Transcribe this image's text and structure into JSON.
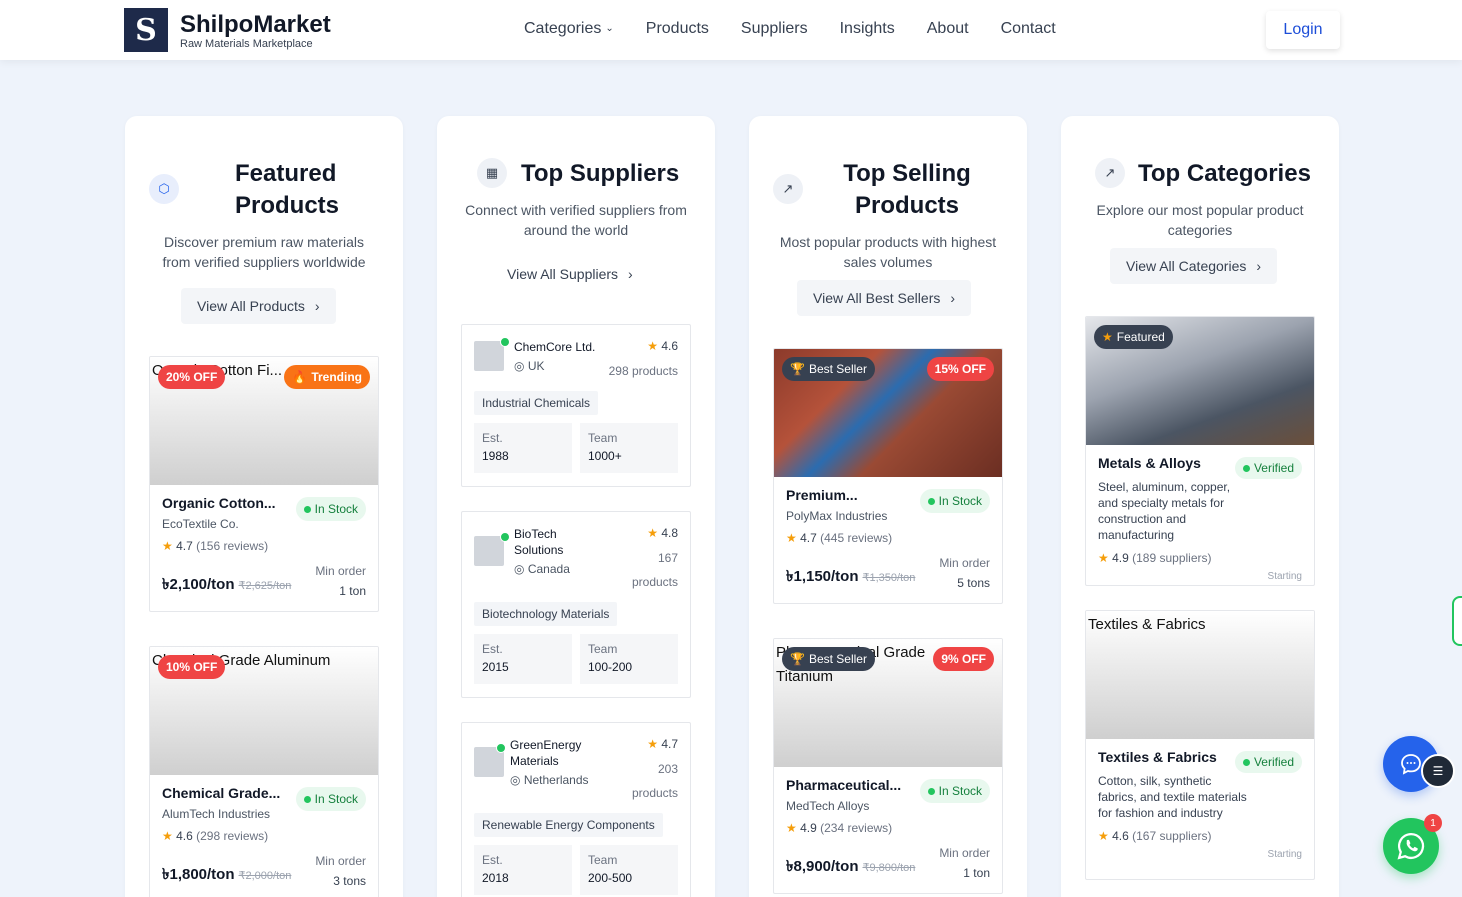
{
  "header": {
    "logo_letter": "S",
    "brand_name": "ShilpoMarket",
    "brand_tagline": "Raw Materials Marketplace",
    "nav": [
      "Categories",
      "Products",
      "Suppliers",
      "Insights",
      "About",
      "Contact"
    ],
    "login": "Login"
  },
  "featured": {
    "title_1": "Featured",
    "title_2": "Products",
    "desc_1": "Discover premium raw materials",
    "desc_2": "from verified suppliers worldwide",
    "view_all": "View All Products",
    "items": [
      {
        "alt": "Organic Cotton Fi...",
        "discount": "20% OFF",
        "tag": "Trending",
        "name": "Organic Cotton...",
        "stock": "In Stock",
        "supplier": "EcoTextile Co.",
        "rating": "4.7",
        "reviews": "(156 reviews)",
        "price": "৳2,100/ton",
        "old_price": "₹2,625/ton",
        "min_label": "Min order",
        "min_value": "1 ton"
      },
      {
        "alt": "Chemical Grade Aluminum",
        "discount": "10% OFF",
        "name": "Chemical Grade...",
        "stock": "In Stock",
        "supplier": "AlumTech Industries",
        "rating": "4.6",
        "reviews": "(298 reviews)",
        "price": "৳1,800/ton",
        "old_price": "₹2,000/ton",
        "min_label": "Min order",
        "min_value": "3 tons"
      }
    ]
  },
  "suppliers": {
    "title": "Top Suppliers",
    "desc_1": "Connect with verified suppliers from",
    "desc_2": "around the world",
    "view_all": "View All Suppliers",
    "items": [
      {
        "name_1": "ChemCore Ltd.",
        "name_2": "",
        "location": "UK",
        "rating": "4.6",
        "count_1": "298 products",
        "count_2": "",
        "tag": "Industrial Chemicals",
        "est_label": "Est.",
        "est": "1988",
        "team_label": "Team",
        "team": "1000+"
      },
      {
        "name_1": "BioTech",
        "name_2": "Solutions",
        "location": "Canada",
        "rating": "4.8",
        "count_1": "167",
        "count_2": "products",
        "tag": "Biotechnology Materials",
        "est_label": "Est.",
        "est": "2015",
        "team_label": "Team",
        "team": "100-200"
      },
      {
        "name_1": "GreenEnergy",
        "name_2": "Materials",
        "location": "Netherlands",
        "rating": "4.7",
        "count_1": "203",
        "count_2": "products",
        "tag": "Renewable Energy Components",
        "est_label": "Est.",
        "est": "2018",
        "team_label": "Team",
        "team": "200-500"
      }
    ]
  },
  "top_selling": {
    "title_1": "Top Selling",
    "title_2": "Products",
    "desc_1": "Most popular products with highest",
    "desc_2": "sales volumes",
    "view_all": "View All Best Sellers",
    "items": [
      {
        "alt": "",
        "tag": "Best Seller",
        "discount": "15% OFF",
        "name": "Premium...",
        "stock": "In Stock",
        "supplier": "PolyMax Industries",
        "rating": "4.7",
        "reviews": "(445 reviews)",
        "price": "৳1,150/ton",
        "old_price": "₹1,350/ton",
        "min_label": "Min order",
        "min_value": "5 tons"
      },
      {
        "alt": "Pharmaceutical Grade Titanium",
        "tag": "Best Seller",
        "discount": "9% OFF",
        "name": "Pharmaceutical...",
        "stock": "In Stock",
        "supplier": "MedTech Alloys",
        "rating": "4.9",
        "reviews": "(234 reviews)",
        "price": "৳8,900/ton",
        "old_price": "₹9,800/ton",
        "min_label": "Min order",
        "min_value": "1 ton"
      }
    ]
  },
  "categories": {
    "title": "Top Categories",
    "desc_1": "Explore our most popular product",
    "desc_2": "categories",
    "view_all": "View All Categories",
    "items": [
      {
        "alt": "",
        "tag": "Featured",
        "name": "Metals & Alloys",
        "verified": "Verified",
        "desc": "Steel, aluminum, copper, and specialty metals for construction and manufacturing",
        "rating": "4.9",
        "suppliers": "(189 suppliers)",
        "more": "Starting"
      },
      {
        "alt": "Textiles & Fabrics",
        "name": "Textiles & Fabrics",
        "verified": "Verified",
        "desc": "Cotton, silk, synthetic fabrics, and textile materials for fashion and industry",
        "rating": "4.6",
        "suppliers": "(167 suppliers)",
        "more": "Starting"
      }
    ]
  },
  "floating": {
    "whatsapp_badge": "1"
  },
  "colors": {
    "brand": "#1e2a4a",
    "accent": "#2563eb",
    "discount": "#ef4444",
    "trending": "#f97316",
    "in_stock": "#15803d",
    "whatsapp": "#22c55e"
  }
}
